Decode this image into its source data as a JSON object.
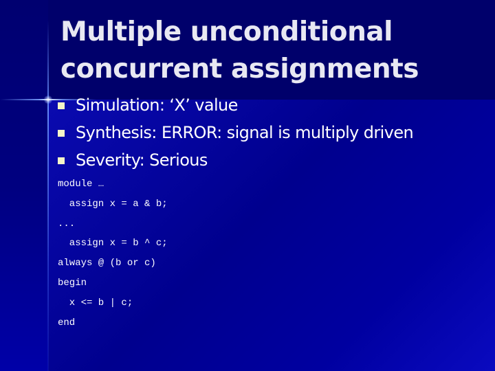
{
  "slide": {
    "title_lines": [
      "Multiple unconditional",
      "concurrent assignments"
    ],
    "bullets": [
      "Simulation: ‘X’ value",
      "Synthesis: ERROR: signal is multiply driven",
      "Severity: Serious"
    ],
    "code_lines": [
      "module …",
      "  assign x = a & b;",
      "...",
      "  assign x = b ^ c;",
      "always @ (b or c)",
      "begin",
      "  x <= b | c;",
      "end"
    ],
    "colors": {
      "background": "#00007a",
      "title_text": "#e8e8f2",
      "bullet_marker": "#f4f4c8",
      "body_text": "#ffffff"
    }
  }
}
